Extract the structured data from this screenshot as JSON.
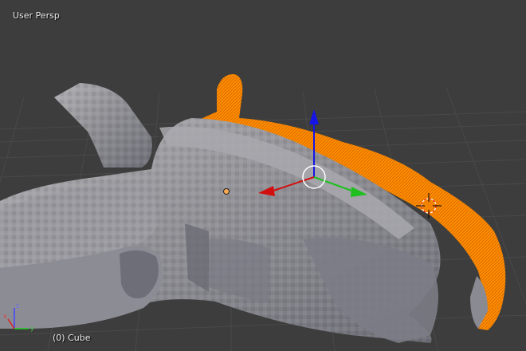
{
  "viewport": {
    "view_label": "User Persp",
    "object_label": "(0) Cube",
    "background_color": "#3d3d3d",
    "grid_color": "#4a4a4a",
    "mesh_color": "#8e8e94",
    "selection_color": "#ff8c00"
  },
  "gizmo": {
    "x_axis_color": "#d20f0f",
    "y_axis_color": "#1fbf1f",
    "z_axis_color": "#1515e6"
  },
  "icons": {
    "transform_gizmo": "transform-manipulator-icon",
    "cursor_3d": "3d-cursor-icon",
    "origin": "object-origin-icon",
    "axis_widget": "axis-orientation-icon"
  }
}
